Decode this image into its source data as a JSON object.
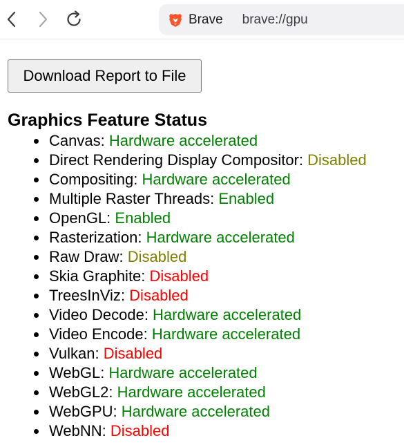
{
  "browser": {
    "site_name": "Brave",
    "url": "brave://gpu",
    "icons": {
      "back": "chevron-left-icon",
      "forward": "chevron-right-icon",
      "reload": "reload-icon",
      "brand": "brave-lion-icon"
    },
    "brand_color": "#fb542b"
  },
  "page": {
    "download_button_label": "Download Report to File",
    "section_title": "Graphics Feature Status",
    "features": [
      {
        "name": "Canvas",
        "separator": ": ",
        "status": "Hardware accelerated",
        "status_color": "#008000"
      },
      {
        "name": "Direct Rendering Display Compositor",
        "separator": ": ",
        "status": "Disabled",
        "status_color": "#808000"
      },
      {
        "name": "Compositing",
        "separator": ": ",
        "status": "Hardware accelerated",
        "status_color": "#008000"
      },
      {
        "name": "Multiple Raster Threads",
        "separator": ": ",
        "status": "Enabled",
        "status_color": "#008000"
      },
      {
        "name": "OpenGL",
        "separator": ": ",
        "status": "Enabled",
        "status_color": "#008000"
      },
      {
        "name": "Rasterization",
        "separator": ": ",
        "status": "Hardware accelerated",
        "status_color": "#008000"
      },
      {
        "name": "Raw Draw",
        "separator": ": ",
        "status": "Disabled",
        "status_color": "#808000"
      },
      {
        "name": "Skia Graphite",
        "separator": ": ",
        "status": "Disabled",
        "status_color": "#ff0000"
      },
      {
        "name": "TreesInViz",
        "separator": ": ",
        "status": "Disabled",
        "status_color": "#ff0000"
      },
      {
        "name": "Video Decode",
        "separator": ": ",
        "status": "Hardware accelerated",
        "status_color": "#008000"
      },
      {
        "name": "Video Encode",
        "separator": ": ",
        "status": "Hardware accelerated",
        "status_color": "#008000"
      },
      {
        "name": "Vulkan",
        "separator": ": ",
        "status": "Disabled",
        "status_color": "#ff0000"
      },
      {
        "name": "WebGL",
        "separator": ": ",
        "status": "Hardware accelerated",
        "status_color": "#008000"
      },
      {
        "name": "WebGL2",
        "separator": ": ",
        "status": "Hardware accelerated",
        "status_color": "#008000"
      },
      {
        "name": "WebGPU",
        "separator": ": ",
        "status": "Hardware accelerated",
        "status_color": "#008000"
      },
      {
        "name": "WebNN",
        "separator": ": ",
        "status": "Disabled",
        "status_color": "#ff0000"
      }
    ]
  }
}
